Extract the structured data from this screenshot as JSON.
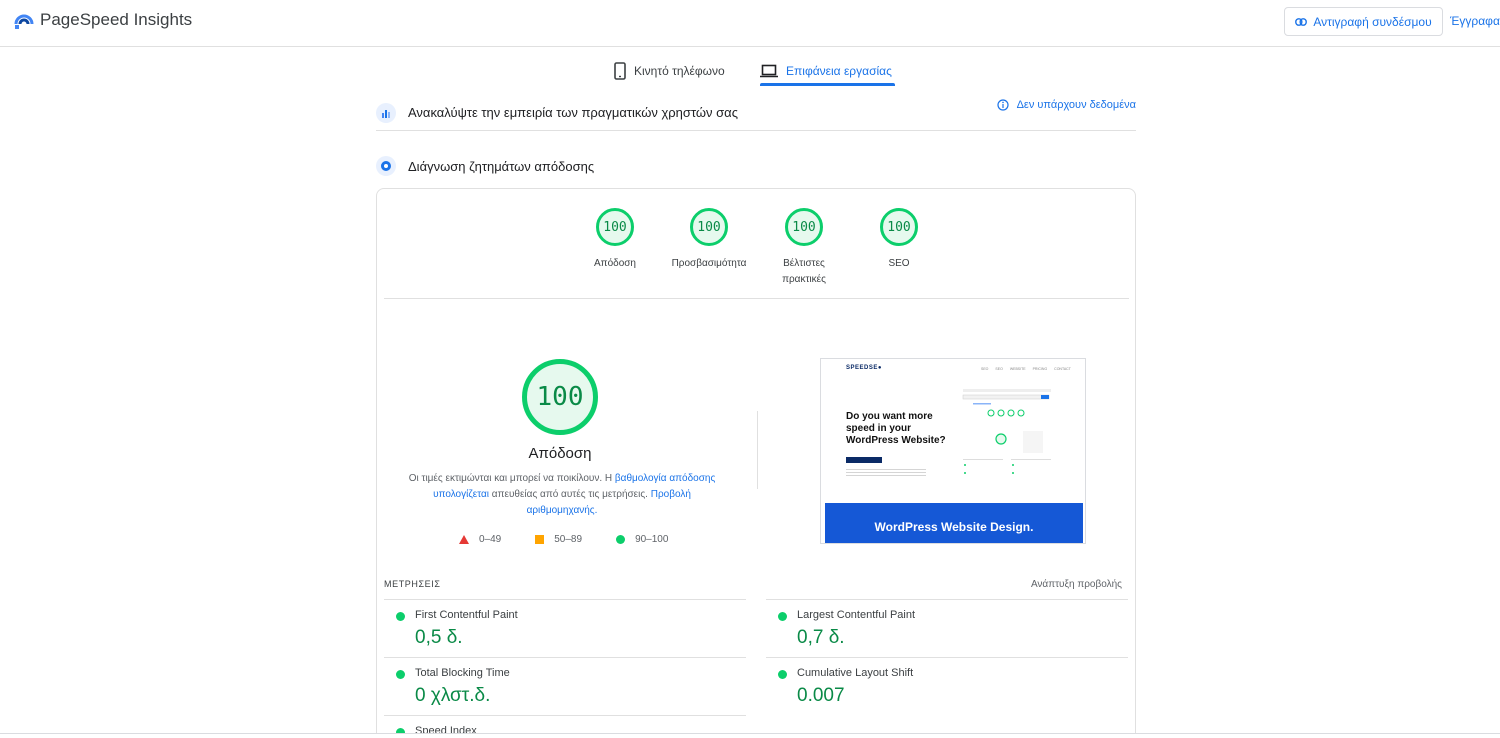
{
  "header": {
    "app_title": "PageSpeed Insights",
    "copy_link_label": "Αντιγραφή συνδέσμου",
    "docs_label": "Έγγραφα"
  },
  "tabs": [
    {
      "label": "Κινητό τηλέφωνο",
      "icon": "phone-icon",
      "active": false
    },
    {
      "label": "Επιφάνεια εργασίας",
      "icon": "laptop-icon",
      "active": true
    }
  ],
  "crux": {
    "title": "Ανακαλύψτε την εμπειρία των πραγματικών χρηστών σας",
    "status": "Δεν υπάρχουν δεδομένα"
  },
  "diagnosis": {
    "title": "Διάγνωση ζητημάτων απόδοσης"
  },
  "scores": [
    {
      "value": "100",
      "label": "Απόδοση"
    },
    {
      "value": "100",
      "label": "Προσβασιμότητα"
    },
    {
      "value": "100",
      "label": "Βέλτιστες πρακτικές"
    },
    {
      "value": "100",
      "label": "SEO"
    }
  ],
  "performance": {
    "score": "100",
    "title": "Απόδοση",
    "desc_1": "Οι τιμές εκτιμώνται και μπορεί να ποικίλουν. Η ",
    "desc_link_1": "βαθμολογία απόδοσης υπολογίζεται",
    "desc_2": " απευθείας από αυτές τις μετρήσεις. ",
    "desc_link_2": "Προβολή αριθμομηχανής.",
    "legend": [
      {
        "range": "0–49",
        "shape": "triangle",
        "color": "#e53935"
      },
      {
        "range": "50–89",
        "shape": "square",
        "color": "#ffa400"
      },
      {
        "range": "90–100",
        "shape": "circle",
        "color": "#0cce6b"
      }
    ]
  },
  "screenshot": {
    "brand": "SPEEDSE●",
    "nav": [
      "SEO",
      "SEO",
      "WEBSITE",
      "PRICING",
      "CONTACT"
    ],
    "heading": "Do you want more speed in your WordPress Website?",
    "band": "WordPress Website Design."
  },
  "metrics": {
    "header": "ΜΕΤΡΗΣΕΙΣ",
    "expand": "Ανάπτυξη προβολής",
    "items": [
      {
        "name": "First Contentful Paint",
        "value": "0,5 δ."
      },
      {
        "name": "Largest Contentful Paint",
        "value": "0,7 δ."
      },
      {
        "name": "Total Blocking Time",
        "value": "0 χλστ.δ."
      },
      {
        "name": "Cumulative Layout Shift",
        "value": "0.007"
      },
      {
        "name": "Speed Index",
        "value": ""
      }
    ]
  },
  "colors": {
    "pass": "#0cce6b",
    "pass_text": "#0a8a47",
    "accent": "#1a73e8"
  }
}
